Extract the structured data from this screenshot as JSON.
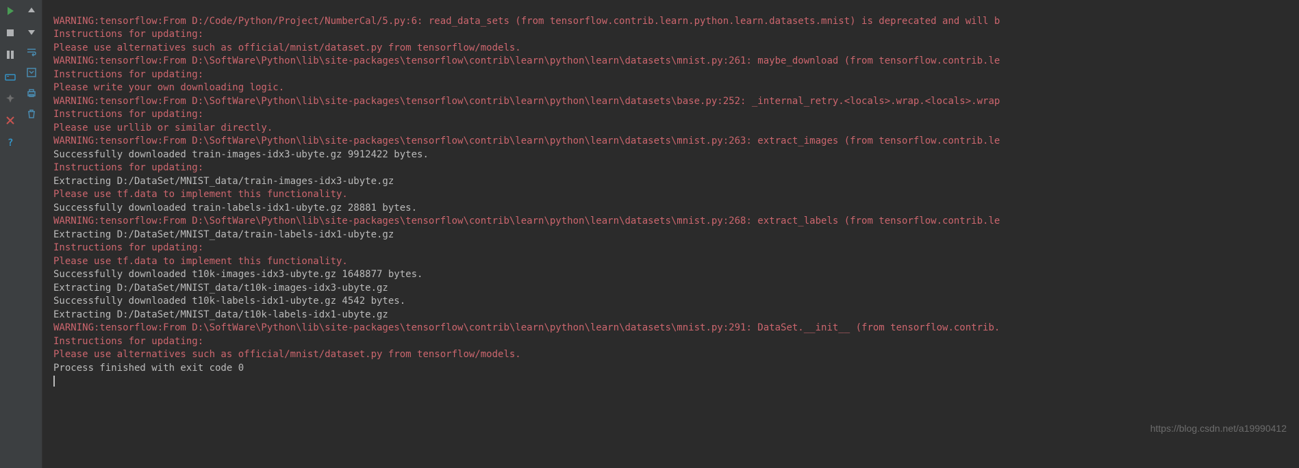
{
  "watermark": "https://blog.csdn.net/a19990412",
  "lines": [
    {
      "cls": "warn",
      "text": "WARNING:tensorflow:From D:/Code/Python/Project/NumberCal/5.py:6: read_data_sets (from tensorflow.contrib.learn.python.learn.datasets.mnist) is deprecated and will b"
    },
    {
      "cls": "warn",
      "text": "Instructions for updating:"
    },
    {
      "cls": "warn",
      "text": "Please use alternatives such as official/mnist/dataset.py from tensorflow/models."
    },
    {
      "cls": "warn",
      "text": "WARNING:tensorflow:From D:\\SoftWare\\Python\\lib\\site-packages\\tensorflow\\contrib\\learn\\python\\learn\\datasets\\mnist.py:261: maybe_download (from tensorflow.contrib.le"
    },
    {
      "cls": "warn",
      "text": "Instructions for updating:"
    },
    {
      "cls": "warn",
      "text": "Please write your own downloading logic."
    },
    {
      "cls": "warn",
      "text": "WARNING:tensorflow:From D:\\SoftWare\\Python\\lib\\site-packages\\tensorflow\\contrib\\learn\\python\\learn\\datasets\\base.py:252: _internal_retry.<locals>.wrap.<locals>.wrap"
    },
    {
      "cls": "warn",
      "text": "Instructions for updating:"
    },
    {
      "cls": "warn",
      "text": "Please use urllib or similar directly."
    },
    {
      "cls": "warn",
      "text": "WARNING:tensorflow:From D:\\SoftWare\\Python\\lib\\site-packages\\tensorflow\\contrib\\learn\\python\\learn\\datasets\\mnist.py:263: extract_images (from tensorflow.contrib.le"
    },
    {
      "cls": "normal",
      "text": "Successfully downloaded train-images-idx3-ubyte.gz 9912422 bytes."
    },
    {
      "cls": "warn",
      "text": "Instructions for updating:"
    },
    {
      "cls": "normal",
      "text": "Extracting D:/DataSet/MNIST_data/train-images-idx3-ubyte.gz"
    },
    {
      "cls": "warn",
      "text": "Please use tf.data to implement this functionality."
    },
    {
      "cls": "normal",
      "text": "Successfully downloaded train-labels-idx1-ubyte.gz 28881 bytes."
    },
    {
      "cls": "warn",
      "text": "WARNING:tensorflow:From D:\\SoftWare\\Python\\lib\\site-packages\\tensorflow\\contrib\\learn\\python\\learn\\datasets\\mnist.py:268: extract_labels (from tensorflow.contrib.le"
    },
    {
      "cls": "normal",
      "text": "Extracting D:/DataSet/MNIST_data/train-labels-idx1-ubyte.gz"
    },
    {
      "cls": "warn",
      "text": "Instructions for updating:"
    },
    {
      "cls": "warn",
      "text": "Please use tf.data to implement this functionality."
    },
    {
      "cls": "normal",
      "text": "Successfully downloaded t10k-images-idx3-ubyte.gz 1648877 bytes."
    },
    {
      "cls": "normal",
      "text": "Extracting D:/DataSet/MNIST_data/t10k-images-idx3-ubyte.gz"
    },
    {
      "cls": "normal",
      "text": "Successfully downloaded t10k-labels-idx1-ubyte.gz 4542 bytes."
    },
    {
      "cls": "normal",
      "text": "Extracting D:/DataSet/MNIST_data/t10k-labels-idx1-ubyte.gz"
    },
    {
      "cls": "warn",
      "text": "WARNING:tensorflow:From D:\\SoftWare\\Python\\lib\\site-packages\\tensorflow\\contrib\\learn\\python\\learn\\datasets\\mnist.py:291: DataSet.__init__ (from tensorflow.contrib."
    },
    {
      "cls": "warn",
      "text": "Instructions for updating:"
    },
    {
      "cls": "warn",
      "text": "Please use alternatives such as official/mnist/dataset.py from tensorflow/models."
    },
    {
      "cls": "normal",
      "text": ""
    },
    {
      "cls": "normal",
      "text": "Process finished with exit code 0"
    }
  ]
}
